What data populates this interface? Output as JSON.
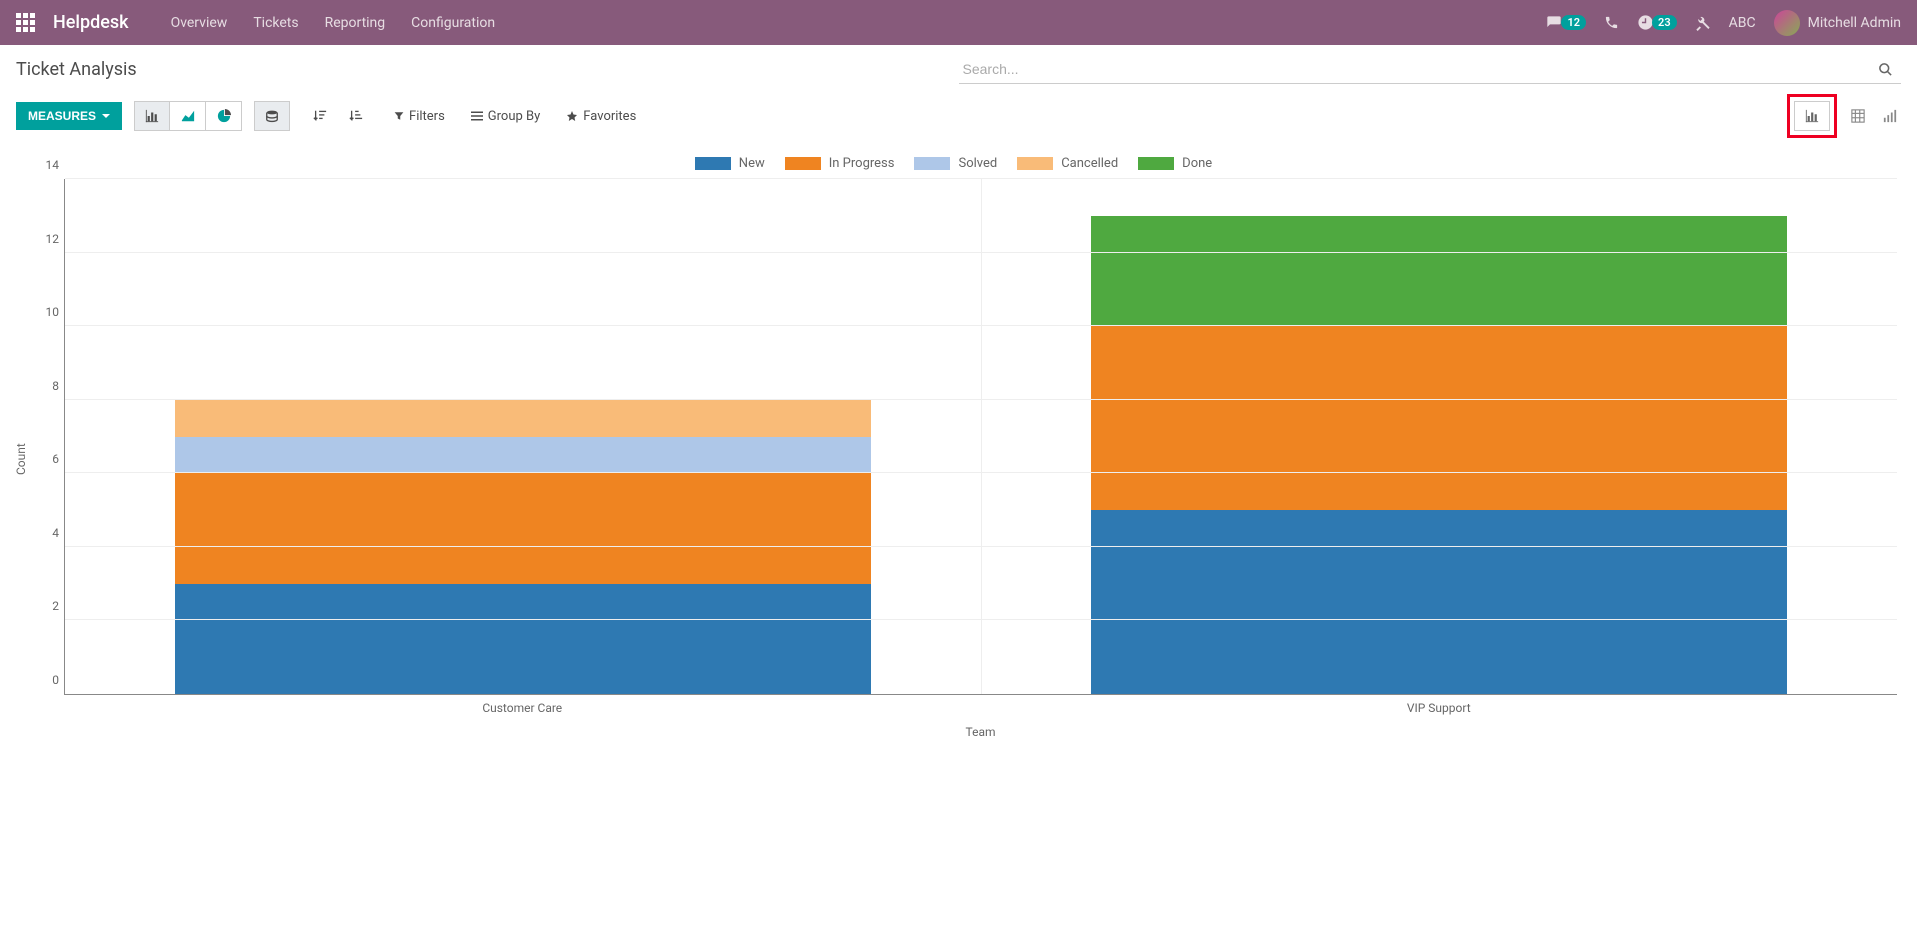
{
  "navbar": {
    "brand": "Helpdesk",
    "links": [
      "Overview",
      "Tickets",
      "Reporting",
      "Configuration"
    ],
    "msg_badge": "12",
    "clock_badge": "23",
    "company": "ABC",
    "user": "Mitchell Admin"
  },
  "page": {
    "title": "Ticket Analysis",
    "search_placeholder": "Search..."
  },
  "toolbar": {
    "measures": "MEASURES",
    "filters": "Filters",
    "group_by": "Group By",
    "favorites": "Favorites"
  },
  "chart_data": {
    "type": "bar",
    "stacked": true,
    "ylabel": "Count",
    "xlabel": "Team",
    "ylim": [
      0,
      14
    ],
    "yticks": [
      0,
      2,
      4,
      6,
      8,
      10,
      12,
      14
    ],
    "categories": [
      "Customer Care",
      "VIP Support"
    ],
    "series": [
      {
        "name": "New",
        "color": "#2E79B2",
        "values": [
          3,
          5
        ]
      },
      {
        "name": "In Progress",
        "color": "#EF8421",
        "values": [
          3,
          5
        ]
      },
      {
        "name": "Solved",
        "color": "#AEC7E8",
        "values": [
          1,
          0
        ]
      },
      {
        "name": "Cancelled",
        "color": "#F9BB78",
        "values": [
          1,
          0
        ]
      },
      {
        "name": "Done",
        "color": "#4FA940",
        "values": [
          0,
          3
        ]
      }
    ]
  }
}
